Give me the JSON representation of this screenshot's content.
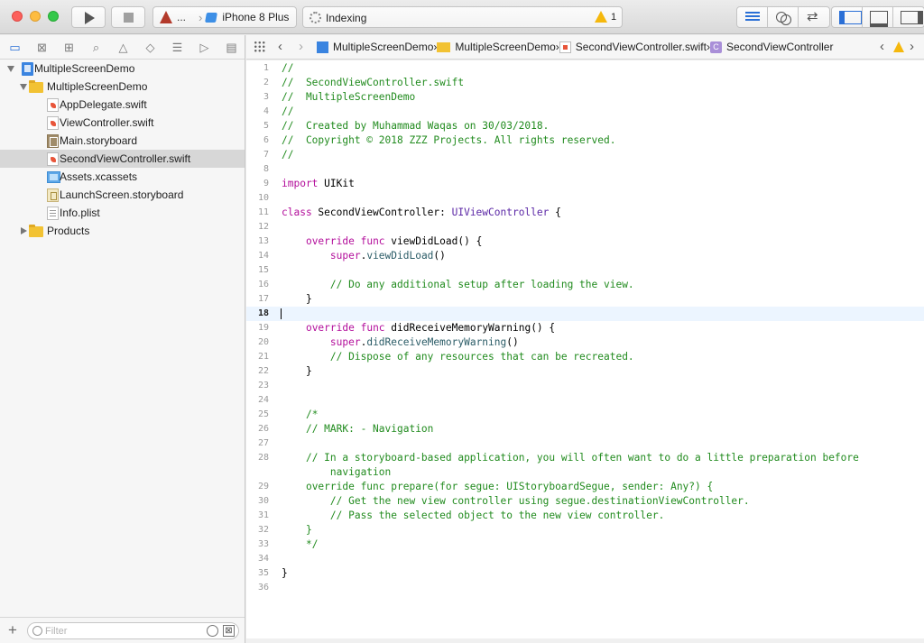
{
  "toolbar": {
    "scheme_name": "...",
    "device": "iPhone 8 Plus",
    "status": "Indexing",
    "warning_count": "1"
  },
  "navigator": {
    "tabs": [
      "project-navigator",
      "source-control",
      "symbol-navigator",
      "find-navigator",
      "issue-navigator",
      "test-navigator",
      "debug-navigator",
      "breakpoint-navigator",
      "report-navigator"
    ],
    "items": [
      {
        "label": "MultipleScreenDemo",
        "type": "project",
        "depth": 0,
        "disclosure": "open"
      },
      {
        "label": "MultipleScreenDemo",
        "type": "folder",
        "depth": 1,
        "disclosure": "open"
      },
      {
        "label": "AppDelegate.swift",
        "type": "swift",
        "depth": 2
      },
      {
        "label": "ViewController.swift",
        "type": "swift",
        "depth": 2
      },
      {
        "label": "Main.storyboard",
        "type": "storyboard",
        "depth": 2
      },
      {
        "label": "SecondViewController.swift",
        "type": "swift",
        "depth": 2,
        "selected": true
      },
      {
        "label": "Assets.xcassets",
        "type": "assets",
        "depth": 2
      },
      {
        "label": "LaunchScreen.storyboard",
        "type": "launch",
        "depth": 2
      },
      {
        "label": "Info.plist",
        "type": "plist",
        "depth": 2
      },
      {
        "label": "Products",
        "type": "folder",
        "depth": 1,
        "disclosure": "closed"
      }
    ],
    "filter_placeholder": "Filter"
  },
  "jumpbar": {
    "crumbs": [
      {
        "label": "MultipleScreenDemo",
        "icon": "project-icon"
      },
      {
        "label": "MultipleScreenDemo",
        "icon": "folder-icon"
      },
      {
        "label": "SecondViewController.swift",
        "icon": "swift-file-icon"
      },
      {
        "label": "SecondViewController",
        "icon": "class-icon"
      }
    ]
  },
  "editor": {
    "current_line": 18,
    "lines": [
      {
        "n": "1",
        "t": [
          [
            "cm",
            "//"
          ]
        ]
      },
      {
        "n": "2",
        "t": [
          [
            "cm",
            "//  SecondViewController.swift"
          ]
        ]
      },
      {
        "n": "3",
        "t": [
          [
            "cm",
            "//  MultipleScreenDemo"
          ]
        ]
      },
      {
        "n": "4",
        "t": [
          [
            "cm",
            "//"
          ]
        ]
      },
      {
        "n": "5",
        "t": [
          [
            "cm",
            "//  Created by Muhammad Waqas on 30/03/2018."
          ]
        ]
      },
      {
        "n": "6",
        "t": [
          [
            "cm",
            "//  Copyright © 2018 ZZZ Projects. All rights reserved."
          ]
        ]
      },
      {
        "n": "7",
        "t": [
          [
            "cm",
            "//"
          ]
        ]
      },
      {
        "n": "8",
        "t": []
      },
      {
        "n": "9",
        "t": [
          [
            "kw",
            "import"
          ],
          [
            "",
            " UIKit"
          ]
        ]
      },
      {
        "n": "10",
        "t": []
      },
      {
        "n": "11",
        "t": [
          [
            "kw",
            "class"
          ],
          [
            "",
            " SecondViewController: "
          ],
          [
            "ty",
            "UIViewController"
          ],
          [
            "",
            " {"
          ]
        ]
      },
      {
        "n": "12",
        "t": []
      },
      {
        "n": "13",
        "t": [
          [
            "",
            "    "
          ],
          [
            "kw",
            "override"
          ],
          [
            "",
            " "
          ],
          [
            "kw",
            "func"
          ],
          [
            "",
            " viewDidLoad() {"
          ]
        ]
      },
      {
        "n": "14",
        "t": [
          [
            "",
            "        "
          ],
          [
            "kw",
            "super"
          ],
          [
            "",
            "."
          ],
          [
            "fn",
            "viewDidLoad"
          ],
          [
            "",
            "()"
          ]
        ]
      },
      {
        "n": "15",
        "t": []
      },
      {
        "n": "16",
        "t": [
          [
            "",
            "        "
          ],
          [
            "cm",
            "// Do any additional setup after loading the view."
          ]
        ]
      },
      {
        "n": "17",
        "t": [
          [
            "",
            "    }"
          ]
        ]
      },
      {
        "n": "18",
        "t": []
      },
      {
        "n": "19",
        "t": [
          [
            "",
            "    "
          ],
          [
            "kw",
            "override"
          ],
          [
            "",
            " "
          ],
          [
            "kw",
            "func"
          ],
          [
            "",
            " didReceiveMemoryWarning() {"
          ]
        ]
      },
      {
        "n": "20",
        "t": [
          [
            "",
            "        "
          ],
          [
            "kw",
            "super"
          ],
          [
            "",
            "."
          ],
          [
            "fn",
            "didReceiveMemoryWarning"
          ],
          [
            "",
            "()"
          ]
        ]
      },
      {
        "n": "21",
        "t": [
          [
            "",
            "        "
          ],
          [
            "cm",
            "// Dispose of any resources that can be recreated."
          ]
        ]
      },
      {
        "n": "22",
        "t": [
          [
            "",
            "    }"
          ]
        ]
      },
      {
        "n": "23",
        "t": []
      },
      {
        "n": "24",
        "t": []
      },
      {
        "n": "25",
        "t": [
          [
            "",
            "    "
          ],
          [
            "cm",
            "/*"
          ]
        ]
      },
      {
        "n": "26",
        "t": [
          [
            "",
            "    "
          ],
          [
            "cm",
            "// MARK: - Navigation"
          ]
        ]
      },
      {
        "n": "27",
        "t": []
      },
      {
        "n": "28",
        "t": [
          [
            "",
            "    "
          ],
          [
            "cm",
            "// In a storyboard-based application, you will often want to do a little preparation before"
          ]
        ]
      },
      {
        "n": "",
        "t": [
          [
            "",
            "        "
          ],
          [
            "cm",
            "navigation"
          ]
        ]
      },
      {
        "n": "29",
        "t": [
          [
            "",
            "    "
          ],
          [
            "cm",
            "override func prepare(for segue: UIStoryboardSegue, sender: Any?) {"
          ]
        ]
      },
      {
        "n": "30",
        "t": [
          [
            "",
            "        "
          ],
          [
            "cm",
            "// Get the new view controller using segue.destinationViewController."
          ]
        ]
      },
      {
        "n": "31",
        "t": [
          [
            "",
            "        "
          ],
          [
            "cm",
            "// Pass the selected object to the new view controller."
          ]
        ]
      },
      {
        "n": "32",
        "t": [
          [
            "",
            "    "
          ],
          [
            "cm",
            "}"
          ]
        ]
      },
      {
        "n": "33",
        "t": [
          [
            "",
            "    "
          ],
          [
            "cm",
            "*/"
          ]
        ]
      },
      {
        "n": "34",
        "t": []
      },
      {
        "n": "35",
        "t": [
          [
            "",
            "}"
          ]
        ]
      },
      {
        "n": "36",
        "t": []
      }
    ]
  }
}
